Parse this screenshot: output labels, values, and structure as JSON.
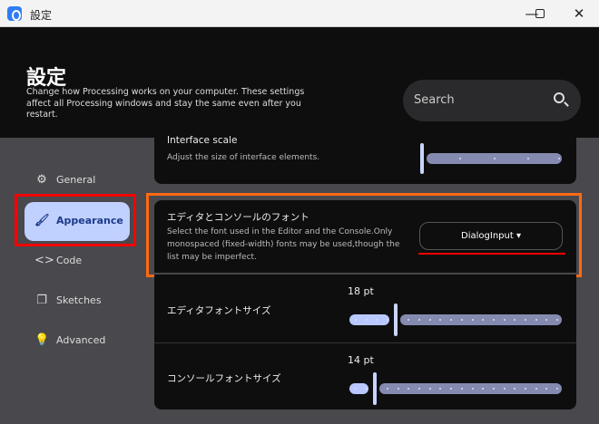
{
  "window": {
    "title": "設定",
    "minimize": "—",
    "maximize": "☐",
    "close": "✕"
  },
  "header": {
    "title": "設定",
    "description": "Change how Processing works on your computer. These settings affect all Processing windows and stay the same even after you restart.",
    "search_placeholder": "Search"
  },
  "sidebar": {
    "items": [
      {
        "label": "General",
        "icon": "gear-icon",
        "glyph": "⚙"
      },
      {
        "label": "Appearance",
        "icon": "brush-icon",
        "glyph": "🖌",
        "selected": true
      },
      {
        "label": "Code",
        "icon": "code-icon",
        "glyph": "<>"
      },
      {
        "label": "Sketches",
        "icon": "windows-icon",
        "glyph": "❐"
      },
      {
        "label": "Advanced",
        "icon": "lightbulb-icon",
        "glyph": "💡"
      }
    ]
  },
  "settings": {
    "interface_scale": {
      "title": "Interface scale",
      "description": "Adjust the size of interface elements.",
      "value_fraction": 0
    },
    "font": {
      "title": "エディタとコンソールのフォント",
      "description": "Select the font used in the Editor and the Console.Only monospaced (fixed-width) fonts may be used,though the list may be imperfect.",
      "selected": "DialogInput",
      "caret": "▾"
    },
    "editor_font_size": {
      "title": "エディタフォントサイズ",
      "value": "18 pt",
      "value_fraction": 0.22
    },
    "console_font_size": {
      "title": "コンソールフォントサイズ",
      "value": "14 pt",
      "value_fraction": 0.12
    }
  },
  "colors": {
    "accent": "#c0d0ff",
    "highlight_red": "#ff0000",
    "highlight_orange": "#ff6a13"
  }
}
